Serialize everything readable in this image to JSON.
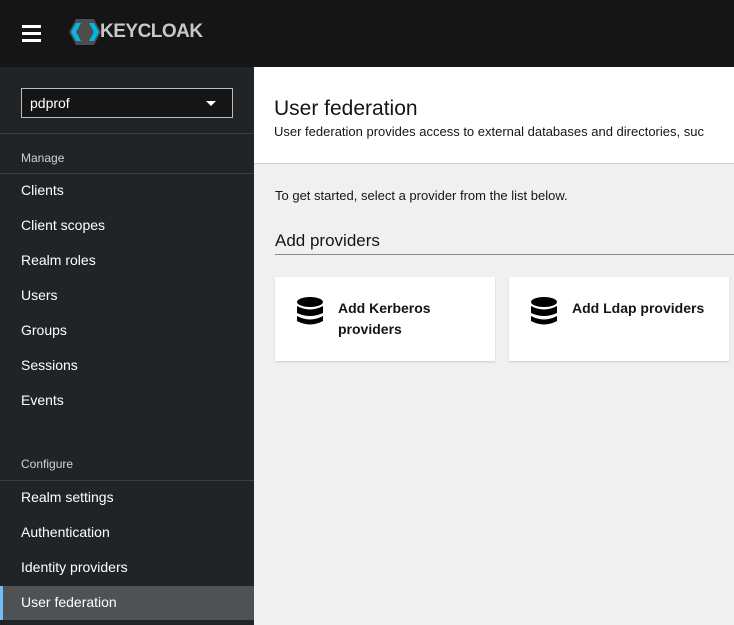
{
  "header": {
    "brand": "KEYCLOAK",
    "menu_icon": "hamburger-icon"
  },
  "sidebar": {
    "realm": "pdprof",
    "manage_label": "Manage",
    "manage": [
      {
        "label": "Clients"
      },
      {
        "label": "Client scopes"
      },
      {
        "label": "Realm roles"
      },
      {
        "label": "Users"
      },
      {
        "label": "Groups"
      },
      {
        "label": "Sessions"
      },
      {
        "label": "Events"
      }
    ],
    "configure_label": "Configure",
    "configure": [
      {
        "label": "Realm settings"
      },
      {
        "label": "Authentication"
      },
      {
        "label": "Identity providers"
      },
      {
        "label": "User federation",
        "active": true
      }
    ]
  },
  "main": {
    "title": "User federation",
    "description": "User federation provides access to external databases and directories, suc",
    "intro": "To get started, select a provider from the list below.",
    "add_heading": "Add providers",
    "cards": [
      {
        "label": "Add Kerberos providers",
        "icon": "database-icon"
      },
      {
        "label": "Add Ldap providers",
        "icon": "database-icon"
      }
    ]
  },
  "colors": {
    "header": "#151515",
    "sidebar": "#212427",
    "active_item": "#4f5255",
    "accent": "#73bcf7"
  }
}
